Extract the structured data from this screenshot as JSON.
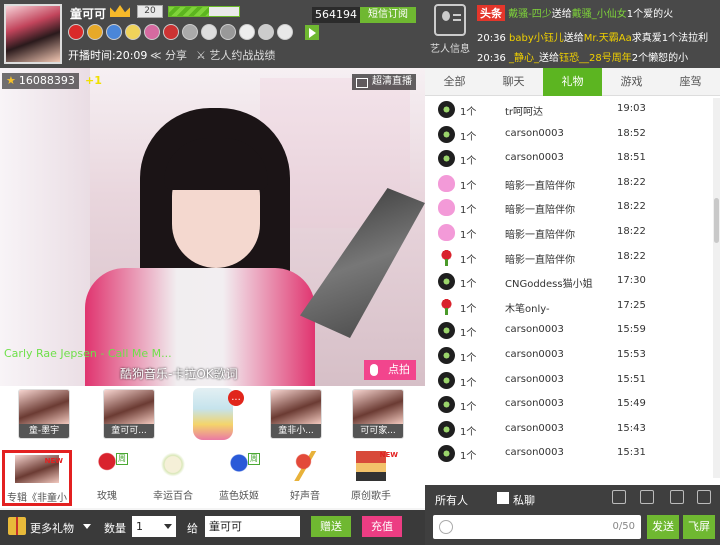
{
  "header": {
    "name": "童可可",
    "level": "20",
    "counter": "564194",
    "subscribe": "短信订阅",
    "uptime": "开播时间:20:09",
    "share": "分享",
    "battle": "艺人约战战绩"
  },
  "video": {
    "fans": "16088393",
    "plus": "+1",
    "hd": "超清直播",
    "song": "Carly Rae Jepsen - Call Me M...",
    "karaoke": "酷狗音乐-卡拉OK歌词",
    "request": "点拍"
  },
  "guests": [
    {
      "label": "童-墨宇"
    },
    {
      "label": "童可可..."
    },
    {
      "label": "童非小..."
    },
    {
      "label": "可可家..."
    }
  ],
  "bottle_badge": "...",
  "gifts": [
    {
      "label": "专辑《非童小",
      "badge": "NEW",
      "selected": true
    },
    {
      "label": "玫瑰",
      "badge": "周"
    },
    {
      "label": "幸运百合",
      "badge": ""
    },
    {
      "label": "蓝色妖姬",
      "badge": "周"
    },
    {
      "label": "好声音",
      "badge": ""
    },
    {
      "label": "原创歌手",
      "badge": "NEW"
    }
  ],
  "giftbar": {
    "more": "更多礼物",
    "qty_label": "数量",
    "qty": "1",
    "to_label": "给",
    "to_name": "童可可",
    "give": "赠送",
    "pay": "充值"
  },
  "right_header": {
    "artist_info": "艺人信息",
    "news": [
      {
        "tag": "头条",
        "a": "戴骚-四少",
        "mid": "送给",
        "b": "戴骚_小仙女",
        "rest": "1个爱的火"
      },
      {
        "time": "20:36",
        "a": "baby小钰儿",
        "mid": "送给",
        "b": "Mr.天霸Aa",
        "rest": "求真爱1个法拉利"
      },
      {
        "time": "20:36",
        "a": "_静心_",
        "mid": "送给",
        "b": "钰恐__28号周年",
        "rest": "2个懒恕的小"
      }
    ]
  },
  "tabs": [
    "全部",
    "聊天",
    "礼物",
    "游戏",
    "座驾"
  ],
  "active_tab": 2,
  "gift_rows": [
    {
      "icon": "ball",
      "count": "1个",
      "who": "tr呵呵达",
      "time": "19:03"
    },
    {
      "icon": "ball",
      "count": "1个",
      "who": "carson0003",
      "time": "18:52"
    },
    {
      "icon": "ball",
      "count": "1个",
      "who": "carson0003",
      "time": "18:51"
    },
    {
      "icon": "heart",
      "count": "1个",
      "who": "暗影一直陪伴你",
      "time": "18:22"
    },
    {
      "icon": "heart",
      "count": "1个",
      "who": "暗影一直陪伴你",
      "time": "18:22"
    },
    {
      "icon": "heart",
      "count": "1个",
      "who": "暗影一直陪伴你",
      "time": "18:22"
    },
    {
      "icon": "rose",
      "count": "1个",
      "who": "暗影一直陪伴你",
      "time": "18:22"
    },
    {
      "icon": "ball",
      "count": "1个",
      "who": "CNGoddess猫小姐",
      "time": "17:30"
    },
    {
      "icon": "rose",
      "count": "1个",
      "who": "木笔only-",
      "time": "17:25"
    },
    {
      "icon": "ball",
      "count": "1个",
      "who": "carson0003",
      "time": "15:59"
    },
    {
      "icon": "ball",
      "count": "1个",
      "who": "carson0003",
      "time": "15:53"
    },
    {
      "icon": "ball",
      "count": "1个",
      "who": "carson0003",
      "time": "15:51"
    },
    {
      "icon": "ball",
      "count": "1个",
      "who": "carson0003",
      "time": "15:49"
    },
    {
      "icon": "ball",
      "count": "1个",
      "who": "carson0003",
      "time": "15:43"
    },
    {
      "icon": "ball",
      "count": "1个",
      "who": "carson0003",
      "time": "15:31"
    }
  ],
  "chatbar": {
    "to": "所有人",
    "private": "私聊",
    "count": "0/50",
    "send": "发送",
    "fly": "飞屏"
  }
}
